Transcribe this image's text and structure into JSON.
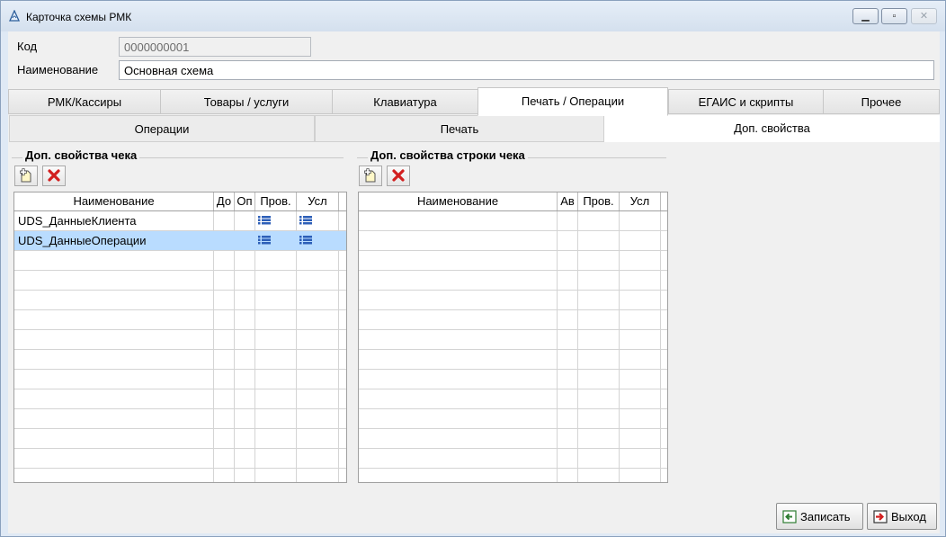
{
  "window": {
    "title": "Карточка схемы РМК"
  },
  "form": {
    "code_label": "Код",
    "code_value": "0000000001",
    "name_label": "Наименование",
    "name_value": "Основная схема"
  },
  "tabs": [
    {
      "label": "РМК/Кассиры",
      "active": false
    },
    {
      "label": "Товары / услуги",
      "active": false
    },
    {
      "label": "Клавиатура",
      "active": false
    },
    {
      "label": "Печать / Операции",
      "active": true
    },
    {
      "label": "ЕГАИС и скрипты",
      "active": false
    },
    {
      "label": "Прочее",
      "active": false
    }
  ],
  "subtabs": [
    {
      "label": "Операции",
      "active": false
    },
    {
      "label": "Печать",
      "active": false
    },
    {
      "label": "Доп. свойства",
      "active": true
    }
  ],
  "receipt_props": {
    "title": "Доп. свойства чека",
    "columns": [
      "Наименование",
      "До",
      "Оп",
      "Пров.",
      "Усл"
    ],
    "rows": [
      {
        "name": "UDS_ДанныеКлиента",
        "check_icon": "list-icon",
        "cond_icon": "list-icon",
        "selected": false
      },
      {
        "name": "UDS_ДанныеОперации",
        "check_icon": "list-icon",
        "cond_icon": "list-icon",
        "selected": true
      }
    ]
  },
  "line_props": {
    "title": "Доп. свойства строки чека",
    "columns": [
      "Наименование",
      "Ав",
      "Пров.",
      "Усл"
    ],
    "rows": []
  },
  "buttons": {
    "save": "Записать",
    "exit": "Выход"
  },
  "colors": {
    "selection": "#b9dcff",
    "window_frame": "#dfe9f5",
    "delete_icon": "#d21f1f"
  }
}
